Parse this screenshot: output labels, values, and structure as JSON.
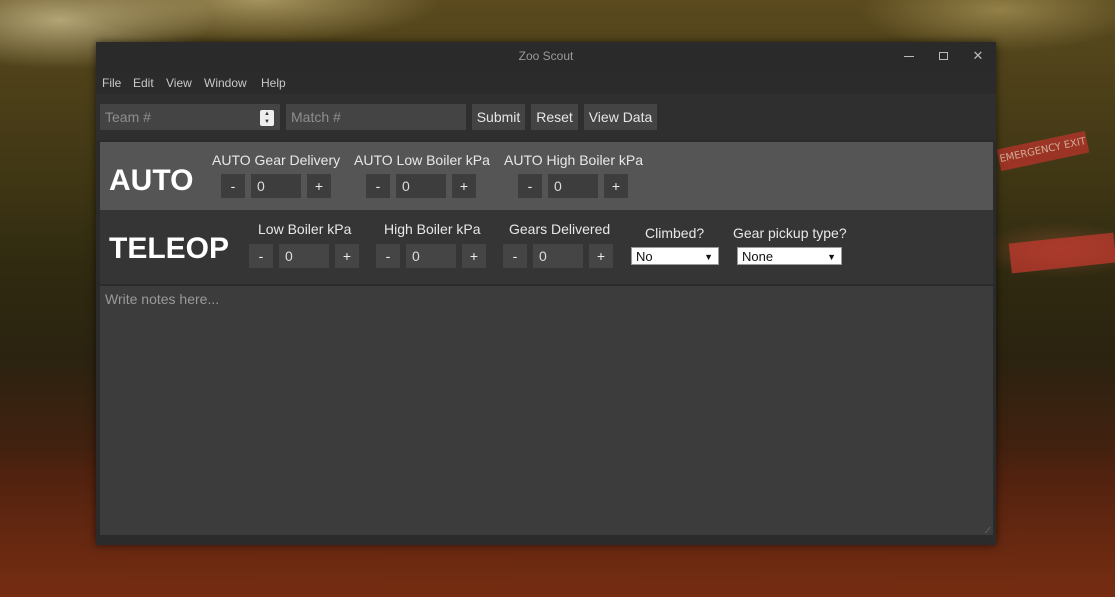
{
  "window": {
    "title": "Zoo Scout"
  },
  "menu": [
    "File",
    "Edit",
    "View",
    "Window",
    "Help"
  ],
  "toolbar": {
    "team_placeholder": "Team #",
    "match_placeholder": "Match #",
    "submit_label": "Submit",
    "reset_label": "Reset",
    "view_data_label": "View Data"
  },
  "auto": {
    "title": "AUTO",
    "counters": [
      {
        "label": "AUTO Gear Delivery",
        "value": "0"
      },
      {
        "label": "AUTO Low Boiler kPa",
        "value": "0"
      },
      {
        "label": "AUTO High Boiler kPa",
        "value": "0"
      }
    ]
  },
  "teleop": {
    "title": "TELEOP",
    "counters": [
      {
        "label": "Low Boiler kPa",
        "value": "0"
      },
      {
        "label": "High Boiler kPa",
        "value": "0"
      },
      {
        "label": "Gears Delivered",
        "value": "0"
      }
    ],
    "climbed": {
      "label": "Climbed?",
      "value": "No"
    },
    "gear_pickup": {
      "label": "Gear pickup type?",
      "value": "None"
    }
  },
  "counter_buttons": {
    "minus": "-",
    "plus": "+"
  },
  "notes": {
    "placeholder": "Write notes here..."
  },
  "background": {
    "exit_sign": "EMERGENCY EXIT"
  }
}
